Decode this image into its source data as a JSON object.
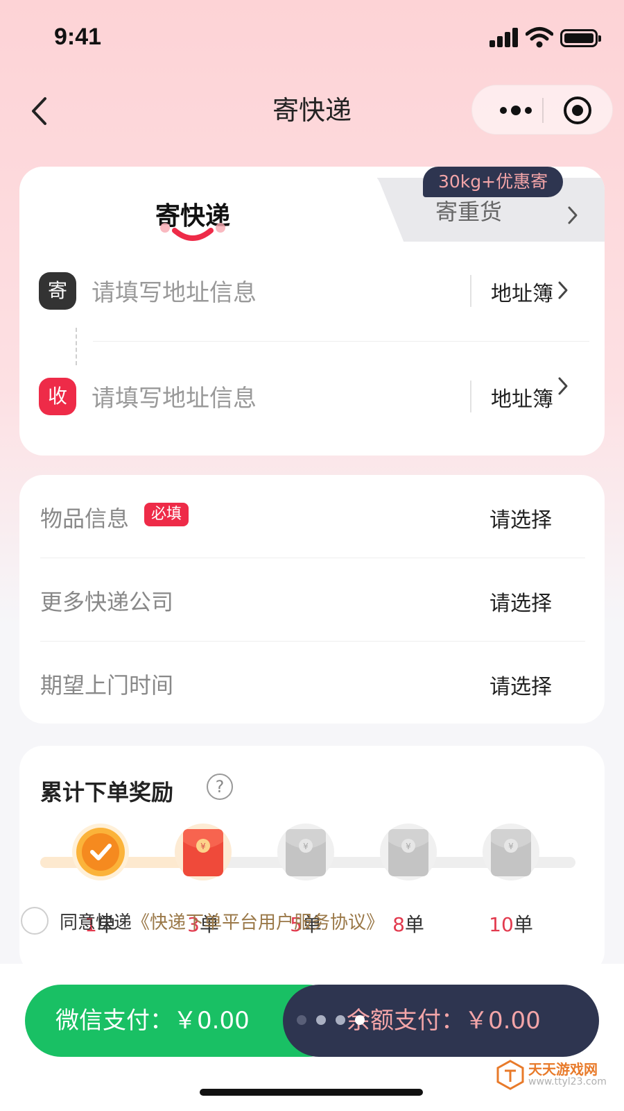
{
  "status_bar": {
    "time": "9:41",
    "signal_icon": "cellular-signal-icon",
    "wifi_icon": "wifi-icon",
    "battery_icon": "battery-icon"
  },
  "nav": {
    "title": "寄快递",
    "back_icon": "chevron-left-icon",
    "more_icon": "more-dots-icon",
    "close_icon": "target-close-icon"
  },
  "tabs": {
    "express": "寄快递",
    "heavy": "寄重货",
    "promo_badge": "30kg+优惠寄"
  },
  "address": {
    "sender": {
      "badge": "寄",
      "placeholder": "请填写地址信息",
      "book_label": "地址簿"
    },
    "receiver": {
      "badge": "收",
      "placeholder": "请填写地址信息",
      "book_label": "地址簿"
    }
  },
  "info": {
    "rows": [
      {
        "label": "物品信息",
        "badge": "必填",
        "value": "请选择"
      },
      {
        "label": "更多快递公司",
        "value": "请选择"
      },
      {
        "label": "期望上门时间",
        "value": "请选择"
      }
    ]
  },
  "reward": {
    "title": "累计下单奖励",
    "help_icon": "question-circle-icon",
    "help_glyph": "?",
    "milestones": [
      {
        "count": "1",
        "unit": "单",
        "state": "completed",
        "icon": "check-badge-icon"
      },
      {
        "count": "3",
        "unit": "单",
        "state": "next",
        "icon": "red-envelope-icon"
      },
      {
        "count": "5",
        "unit": "单",
        "state": "locked",
        "icon": "red-envelope-icon"
      },
      {
        "count": "8",
        "unit": "单",
        "state": "locked",
        "icon": "red-envelope-icon"
      },
      {
        "count": "10",
        "unit": "单",
        "state": "locked",
        "icon": "red-envelope-icon"
      }
    ],
    "progress_fraction": 0.33
  },
  "agreement": {
    "prefix": "同意快递",
    "link": "《快递下单平台用户服务协议》"
  },
  "payment": {
    "wechat": "微信支付：￥0.00",
    "balance": "余额支付：￥0.00"
  },
  "watermark": {
    "text": "天天游戏网",
    "url": "www.ttyl23.com"
  },
  "colors": {
    "accent_red": "#ee2b48",
    "wechat_green": "#19c064",
    "navy": "#2e3550",
    "promo_pink": "#f3a5a8",
    "link_gold": "#9a7848"
  }
}
